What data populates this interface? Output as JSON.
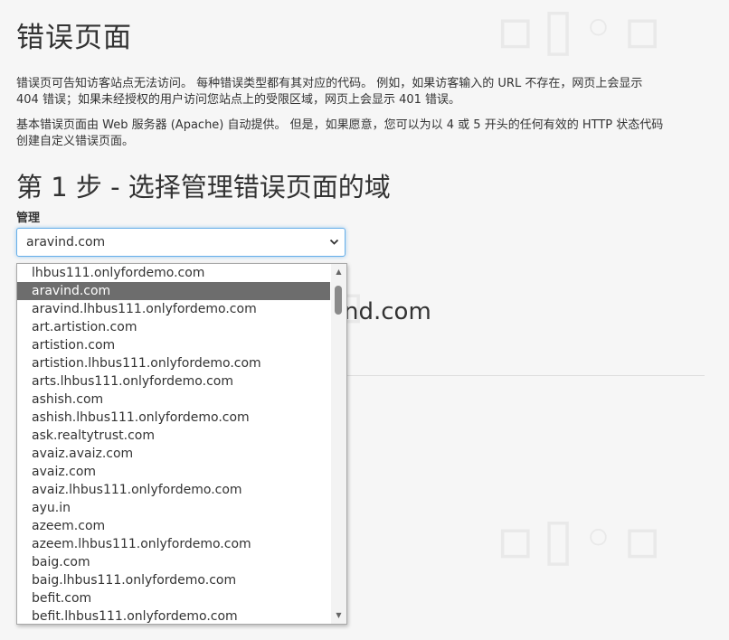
{
  "page": {
    "title": "错误页面",
    "intro_line1": "错误页可告知访客站点无法访问。 每种错误类型都有其对应的代码。 例如，如果访客输入的 URL 不存在，网页上会显示",
    "intro_line2": "404 错误；如果未经授权的用户访问您站点上的受限区域，网页上会显示 401 错误。",
    "basic_line1": "基本错误页面由 Web 服务器 (Apache) 自动提供。 但是，如果愿意，您可以为以 4 或 5 开头的任何有效的 HTTP 状态代码",
    "basic_line2": "创建自定义错误页面。"
  },
  "step1": {
    "title": "第 1 步 - 选择管理错误页面的域",
    "label": "管理",
    "selected_value": "aravind.com",
    "behind_text": "nd.com"
  },
  "dropdown": {
    "options": [
      "lhbus111.onlyfordemo.com",
      "aravind.com",
      "aravind.lhbus111.onlyfordemo.com",
      "art.artistion.com",
      "artistion.com",
      "artistion.lhbus111.onlyfordemo.com",
      "arts.lhbus111.onlyfordemo.com",
      "ashish.com",
      "ashish.lhbus111.onlyfordemo.com",
      "ask.realtytrust.com",
      "avaiz.avaiz.com",
      "avaiz.com",
      "avaiz.lhbus111.onlyfordemo.com",
      "ayu.in",
      "azeem.com",
      "azeem.lhbus111.onlyfordemo.com",
      "baig.com",
      "baig.lhbus111.onlyfordemo.com",
      "befit.com",
      "befit.lhbus111.onlyfordemo.com"
    ],
    "selected_index": 1
  },
  "icons": {
    "select_chevron": "chevron-down-icon",
    "scroll_up": "scroll-up-arrow-icon",
    "scroll_down": "scroll-down-arrow-icon"
  },
  "colors": {
    "focus_border": "#66afe9",
    "selected_option_bg": "#6d6d6d",
    "page_bg": "#f6f6f6"
  }
}
